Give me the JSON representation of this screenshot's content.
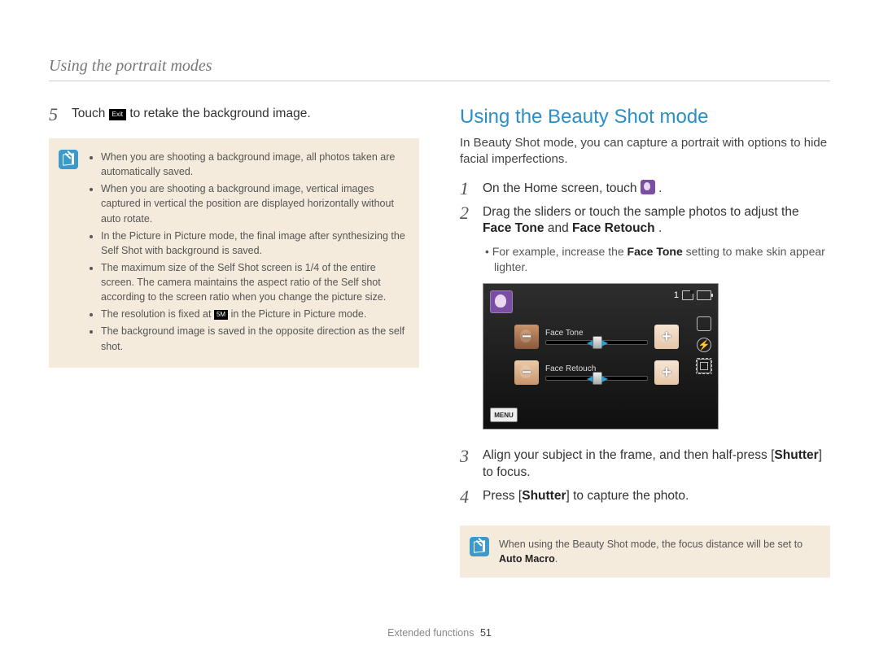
{
  "header": "Using the portrait modes",
  "left": {
    "step5_num": "5",
    "step5_a": "Touch ",
    "step5_exit": "Exit",
    "step5_b": " to retake the background image.",
    "notes": [
      "When you are shooting a background image, all photos taken are automatically saved.",
      "When you are shooting a background image, vertical images captured in vertical the position are displayed horizontally without auto rotate.",
      "In the Picture in Picture mode, the final image after synthesizing the Self Shot with background is saved.",
      "The maximum size of the Self Shot screen is 1/4 of the entire screen. The camera maintains the aspect ratio of the Self shot according to the screen ratio when you change the picture size.",
      "__RES__",
      "The background image is saved in the opposite direction as the self shot."
    ],
    "res_a": "The resolution is fixed at ",
    "res_badge": "5M",
    "res_b": " in the Picture in Picture mode."
  },
  "right": {
    "title": "Using the Beauty Shot mode",
    "intro": "In Beauty Shot mode, you can capture a portrait with options to hide facial imperfections.",
    "step1_num": "1",
    "step1_a": "On the Home screen, touch ",
    "step1_b": ".",
    "step2_num": "2",
    "step2_a": "Drag the sliders or touch the sample photos to adjust the ",
    "step2_bold1": "Face Tone",
    "step2_mid": " and ",
    "step2_bold2": "Face Retouch",
    "step2_b": ".",
    "sub_a": "For example, increase the ",
    "sub_bold": "Face Tone",
    "sub_b": " setting to make skin appear lighter.",
    "camera": {
      "count": "1",
      "slider1": "Face Tone",
      "slider2": "Face Retouch",
      "menu": "MENU"
    },
    "step3_num": "3",
    "step3_a": "Align your subject in the frame, and then half-press [",
    "step3_bold": "Shutter",
    "step3_b": "] to focus.",
    "step4_num": "4",
    "step4_a": "Press [",
    "step4_bold": "Shutter",
    "step4_b": "] to capture the photo.",
    "note_a": "When using the Beauty Shot mode, the focus distance will be set to ",
    "note_bold": "Auto Macro",
    "note_b": "."
  },
  "footer": {
    "section": "Extended functions",
    "page": "51"
  }
}
